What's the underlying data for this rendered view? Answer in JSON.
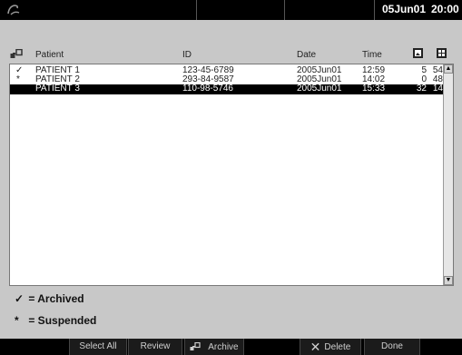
{
  "header": {
    "date": "05Jun01",
    "time": "20:00"
  },
  "columns": {
    "patient": "Patient",
    "id": "ID",
    "date": "Date",
    "time": "Time"
  },
  "rows": [
    {
      "status": "✓",
      "patient": "PATIENT 1",
      "id": "123-45-6789",
      "date": "2005Jun01",
      "time": "12:59",
      "count1": "5",
      "count2": "54"
    },
    {
      "status": "*",
      "patient": "PATIENT 2",
      "id": "293-84-9587",
      "date": "2005Jun01",
      "time": "14:02",
      "count1": "0",
      "count2": "48"
    },
    {
      "status": "",
      "patient": "PATIENT 3",
      "id": "110-98-5746",
      "date": "2005Jun01",
      "time": "15:33",
      "count1": "32",
      "count2": "14"
    }
  ],
  "legend": {
    "archived_mark": "✓",
    "archived_label": "= Archived",
    "suspended_mark": "*",
    "suspended_label": "= Suspended"
  },
  "toolbar": {
    "select_all": "Select All",
    "review": "Review",
    "archive": "Archive",
    "delete": "Delete",
    "done": "Done"
  },
  "icons": {
    "top_logo": "logo-icon",
    "header_left": "network-icon",
    "header_col1": "image-icon",
    "header_col2": "frames-icon",
    "archive": "archive-icon",
    "delete": "close-icon"
  },
  "colors": {
    "background": "#c8c8c8",
    "bars": "#000000",
    "selected_row": "#000000"
  }
}
